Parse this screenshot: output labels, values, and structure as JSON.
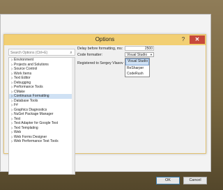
{
  "window": {
    "title": "Options",
    "help_label": "?",
    "close_label": "✕"
  },
  "search": {
    "placeholder": "Search Options (Ctrl+E)",
    "icon": "search-icon"
  },
  "tree": {
    "items": [
      {
        "label": "Environment",
        "expandable": true
      },
      {
        "label": "Projects and Solutions",
        "expandable": true
      },
      {
        "label": "Source Control",
        "expandable": true
      },
      {
        "label": "Work Items",
        "expandable": true
      },
      {
        "label": "Text Editor",
        "expandable": true
      },
      {
        "label": "Debugging",
        "expandable": true
      },
      {
        "label": "Performance Tools",
        "expandable": true
      },
      {
        "label": "CMake",
        "expandable": true
      },
      {
        "label": "Continuous Formatting",
        "expandable": true,
        "selected": true
      },
      {
        "label": "Database Tools",
        "expandable": true
      },
      {
        "label": "F#",
        "expandable": true
      },
      {
        "label": "Graphics Diagnostics",
        "expandable": true
      },
      {
        "label": "NuGet Package Manager",
        "expandable": true
      },
      {
        "label": "Test",
        "expandable": true
      },
      {
        "label": "Test Adapter for Google Test",
        "expandable": true
      },
      {
        "label": "Text Templating",
        "expandable": true
      },
      {
        "label": "Web",
        "expandable": true
      },
      {
        "label": "Web Forms Designer",
        "expandable": true
      },
      {
        "label": "Web Performance Test Tools",
        "expandable": true
      }
    ]
  },
  "settings": {
    "delay_label": "Delay before formatting, ms:",
    "delay_value": "2500",
    "formatter_label": "Code formatter:",
    "formatter_value": "Visual Studio",
    "registered_text": "Registered to Sergey Vlasov"
  },
  "dropdown": {
    "options": [
      "Visual Studio",
      "ReSharper",
      "CodeRush"
    ],
    "highlighted_index": 0
  },
  "buttons": {
    "ok": "OK",
    "cancel": "Cancel"
  },
  "colors": {
    "titlebar": "#f2cf73",
    "selection": "#cfe1f4",
    "close": "#c7493a"
  }
}
